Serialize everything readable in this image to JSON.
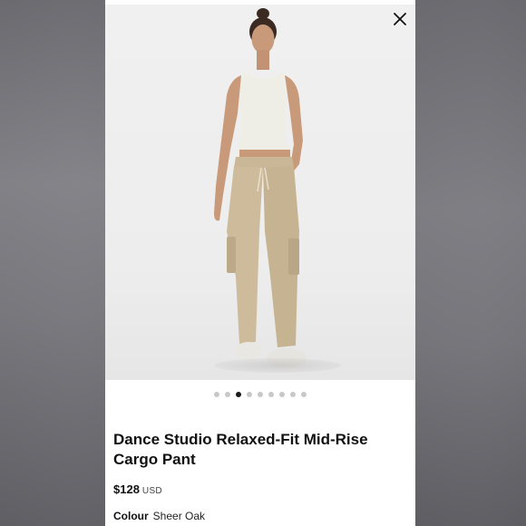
{
  "product": {
    "title": "Dance Studio Relaxed-Fit Mid-Rise Cargo Pant",
    "price": "$128",
    "currency": "USD",
    "colour_label": "Colour",
    "colour_value": "Sheer Oak"
  },
  "gallery": {
    "total_images": 9,
    "active_index": 2
  },
  "colors": {
    "pant": "#cdbb9b",
    "top": "#efeee6",
    "skin": "#c99a7a",
    "background": "#efefef"
  }
}
